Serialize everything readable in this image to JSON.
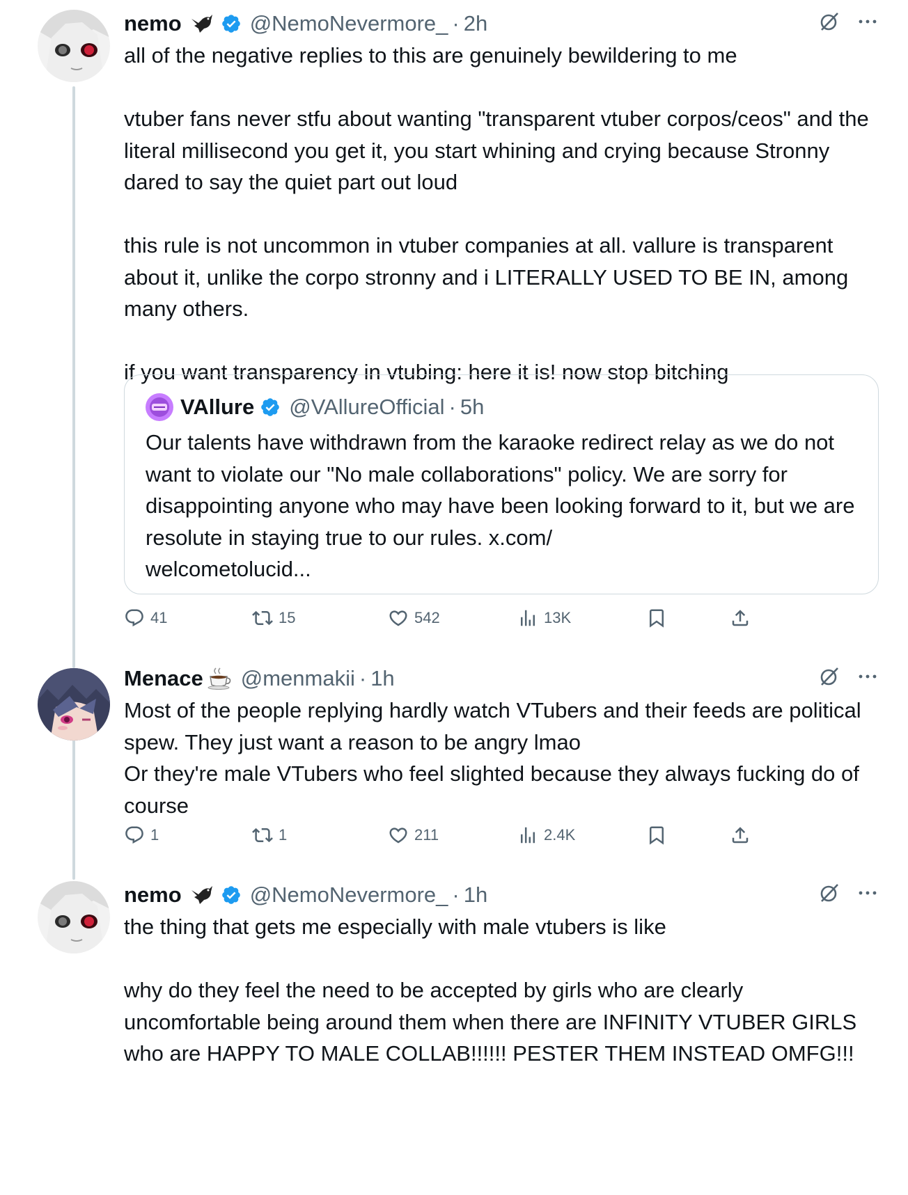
{
  "colors": {
    "text": "#0f1419",
    "secondary": "#536471",
    "verified": "#1d9bf0",
    "border": "#cfd9de"
  },
  "tweets": [
    {
      "name": "nemo",
      "name_emoji": "bird-icon",
      "handle": "@NemoNevermore_",
      "time": "2h",
      "text": "all of the negative replies to this are genuinely bewildering to me\n\nvtuber fans never stfu about wanting \"transparent vtuber corpos/ceos\" and the literal millisecond you get it, you start whining and crying because Stronny dared to say the quiet part out loud\n\nthis rule is not uncommon in vtuber companies at all. vallure is transparent about it, unlike the corpo stronny and i LITERALLY USED TO BE IN, among many others.\n\nif you want transparency in vtubing: here it is! now stop bitching",
      "quote": {
        "name": "VAllure",
        "handle": "@VAllureOfficial",
        "time": "5h",
        "text": "Our talents have withdrawn from the karaoke redirect relay as we do not want to violate our \"No male collaborations\" policy. We are sorry for disappointing anyone who may have been looking forward to it, but we are resolute in staying true to our rules. x.com/\nwelcometolucid..."
      },
      "replies": "41",
      "reposts": "15",
      "likes": "542",
      "views": "13K"
    },
    {
      "name": "Menace",
      "name_emoji": "coffee-icon",
      "handle": "@menmakii",
      "time": "1h",
      "text": "Most of the people replying hardly watch VTubers and their feeds are political spew. They just want a reason to be angry lmao\nOr they're male VTubers who feel slighted because they always fucking do of course",
      "replies": "1",
      "reposts": "1",
      "likes": "211",
      "views": "2.4K"
    },
    {
      "name": "nemo",
      "name_emoji": "bird-icon",
      "handle": "@NemoNevermore_",
      "time": "1h",
      "text": "the thing that gets me especially with male vtubers is like\n\nwhy do they feel the need to be accepted by girls who are clearly uncomfortable being around them when there are INFINITY VTUBER GIRLS who are HAPPY TO MALE COLLAB!!!!!! PESTER THEM INSTEAD OMFG!!!"
    }
  ]
}
